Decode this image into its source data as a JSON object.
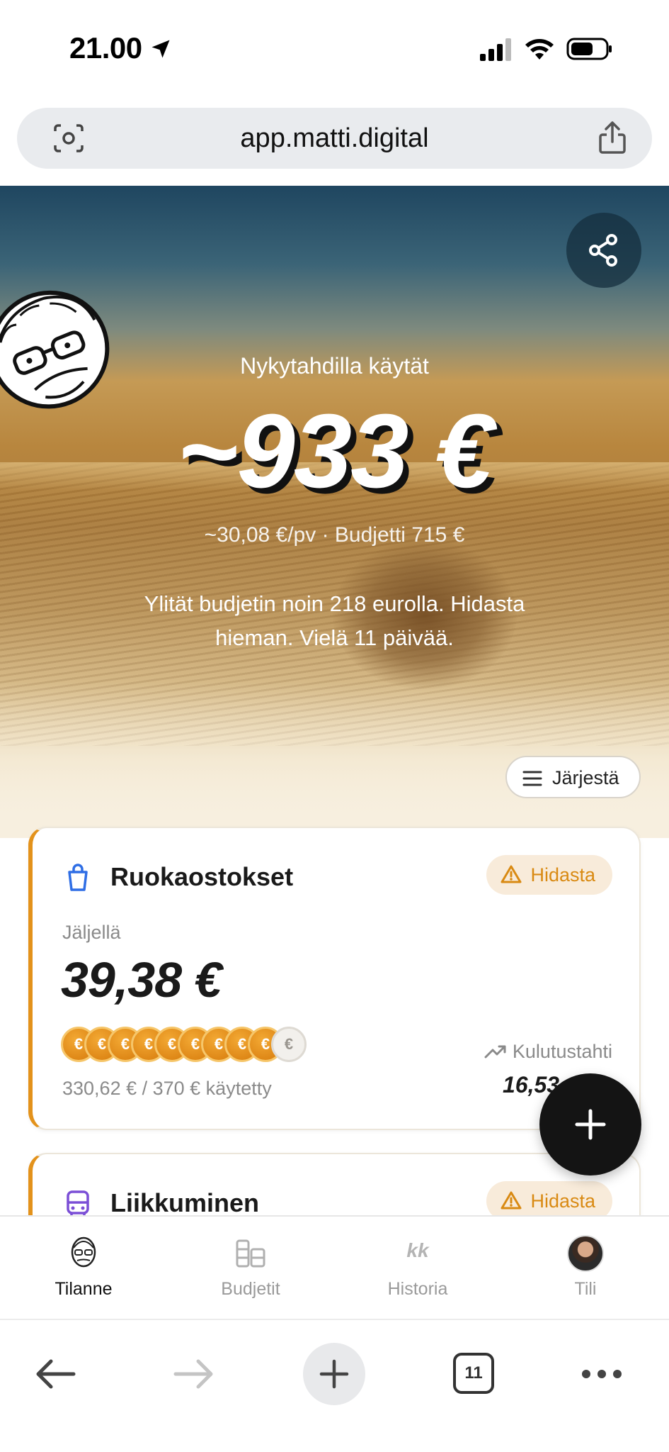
{
  "status_bar": {
    "time": "21.00"
  },
  "url_bar": {
    "url": "app.matti.digital"
  },
  "hero": {
    "label": "Nykytahdilla käytät",
    "amount": "~933 €",
    "sub": "~30,08 €/pv · Budjetti 715 €",
    "message": "Ylität budjetin noin 218 eurolla. Hidasta hieman. Vielä 11 päivää.",
    "sort_label": "Järjestä"
  },
  "cards": [
    {
      "title": "Ruokaostokset",
      "badge": "Hidasta",
      "left_label": "Jäljellä",
      "left_amount": "39,38 €",
      "coin_symbol": "€",
      "coins_filled": 9,
      "coins_total": 10,
      "spent_text": "330,62 € / 370 € käytetty",
      "pace_label": "Kulutustahti",
      "pace_value": "16,53 €"
    },
    {
      "title": "Liikkuminen",
      "badge": "Hidasta"
    }
  ],
  "nav": {
    "items": [
      {
        "label": "Tilanne",
        "icon": "mascot-face-icon",
        "active": true
      },
      {
        "label": "Budjetit",
        "icon": "budget-stack-icon",
        "active": false
      },
      {
        "label": "Historia",
        "icon": "kk-history-icon",
        "glyph": "kk",
        "active": false
      },
      {
        "label": "Tili",
        "icon": "avatar-icon",
        "active": false
      }
    ]
  },
  "browser_bar": {
    "tab_count": "11"
  },
  "colors": {
    "accent_orange": "#e3921b",
    "badge_bg": "#f8ebda",
    "fab_bg": "#141414"
  }
}
